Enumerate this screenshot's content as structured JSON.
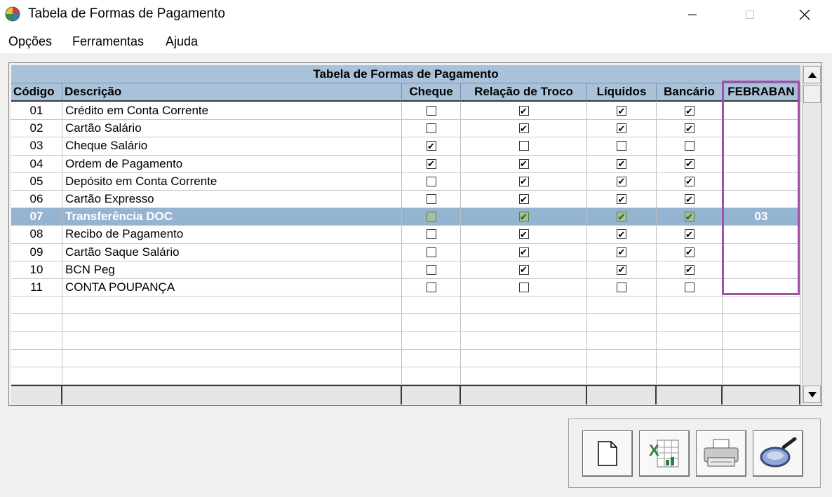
{
  "window": {
    "title": "Tabela de Formas de Pagamento"
  },
  "menu": [
    "Opções",
    "Ferramentas",
    "Ajuda"
  ],
  "grid": {
    "title": "Tabela de Formas de Pagamento",
    "columns": [
      "Código",
      "Descrição",
      "Cheque",
      "Relação de Troco",
      "Líquidos",
      "Bancário",
      "FEBRABAN"
    ],
    "rows": [
      {
        "code": "01",
        "desc": "Crédito em Conta Corrente",
        "cheque": false,
        "troco": true,
        "liquidos": true,
        "bancario": true,
        "febraban": ""
      },
      {
        "code": "02",
        "desc": "Cartão Salário",
        "cheque": false,
        "troco": true,
        "liquidos": true,
        "bancario": true,
        "febraban": ""
      },
      {
        "code": "03",
        "desc": "Cheque Salário",
        "cheque": true,
        "troco": false,
        "liquidos": false,
        "bancario": false,
        "febraban": ""
      },
      {
        "code": "04",
        "desc": "Ordem de Pagamento",
        "cheque": true,
        "troco": true,
        "liquidos": true,
        "bancario": true,
        "febraban": ""
      },
      {
        "code": "05",
        "desc": "Depósito em Conta Corrente",
        "cheque": false,
        "troco": true,
        "liquidos": true,
        "bancario": true,
        "febraban": ""
      },
      {
        "code": "06",
        "desc": "Cartão Expresso",
        "cheque": false,
        "troco": true,
        "liquidos": true,
        "bancario": true,
        "febraban": ""
      },
      {
        "code": "07",
        "desc": "Transferência DOC",
        "cheque": false,
        "troco": true,
        "liquidos": true,
        "bancario": true,
        "febraban": "03",
        "selected": true
      },
      {
        "code": "08",
        "desc": "Recibo de Pagamento",
        "cheque": false,
        "troco": true,
        "liquidos": true,
        "bancario": true,
        "febraban": ""
      },
      {
        "code": "09",
        "desc": "Cartão Saque Salário",
        "cheque": false,
        "troco": true,
        "liquidos": true,
        "bancario": true,
        "febraban": ""
      },
      {
        "code": "10",
        "desc": "BCN Peg",
        "cheque": false,
        "troco": true,
        "liquidos": true,
        "bancario": true,
        "febraban": ""
      },
      {
        "code": "11",
        "desc": "CONTA POUPANÇA",
        "cheque": false,
        "troco": false,
        "liquidos": false,
        "bancario": false,
        "febraban": ""
      }
    ],
    "empty_rows": 5
  },
  "toolbar": {
    "buttons": [
      {
        "name": "new-document-button",
        "icon": "new-document-icon"
      },
      {
        "name": "export-excel-button",
        "icon": "excel-icon"
      },
      {
        "name": "print-button",
        "icon": "printer-icon"
      },
      {
        "name": "search-button",
        "icon": "magnifier-icon"
      }
    ]
  },
  "colors": {
    "header": "#a9c2da",
    "selected_row": "#95b4d1",
    "highlight_box": "#a24fa8"
  }
}
